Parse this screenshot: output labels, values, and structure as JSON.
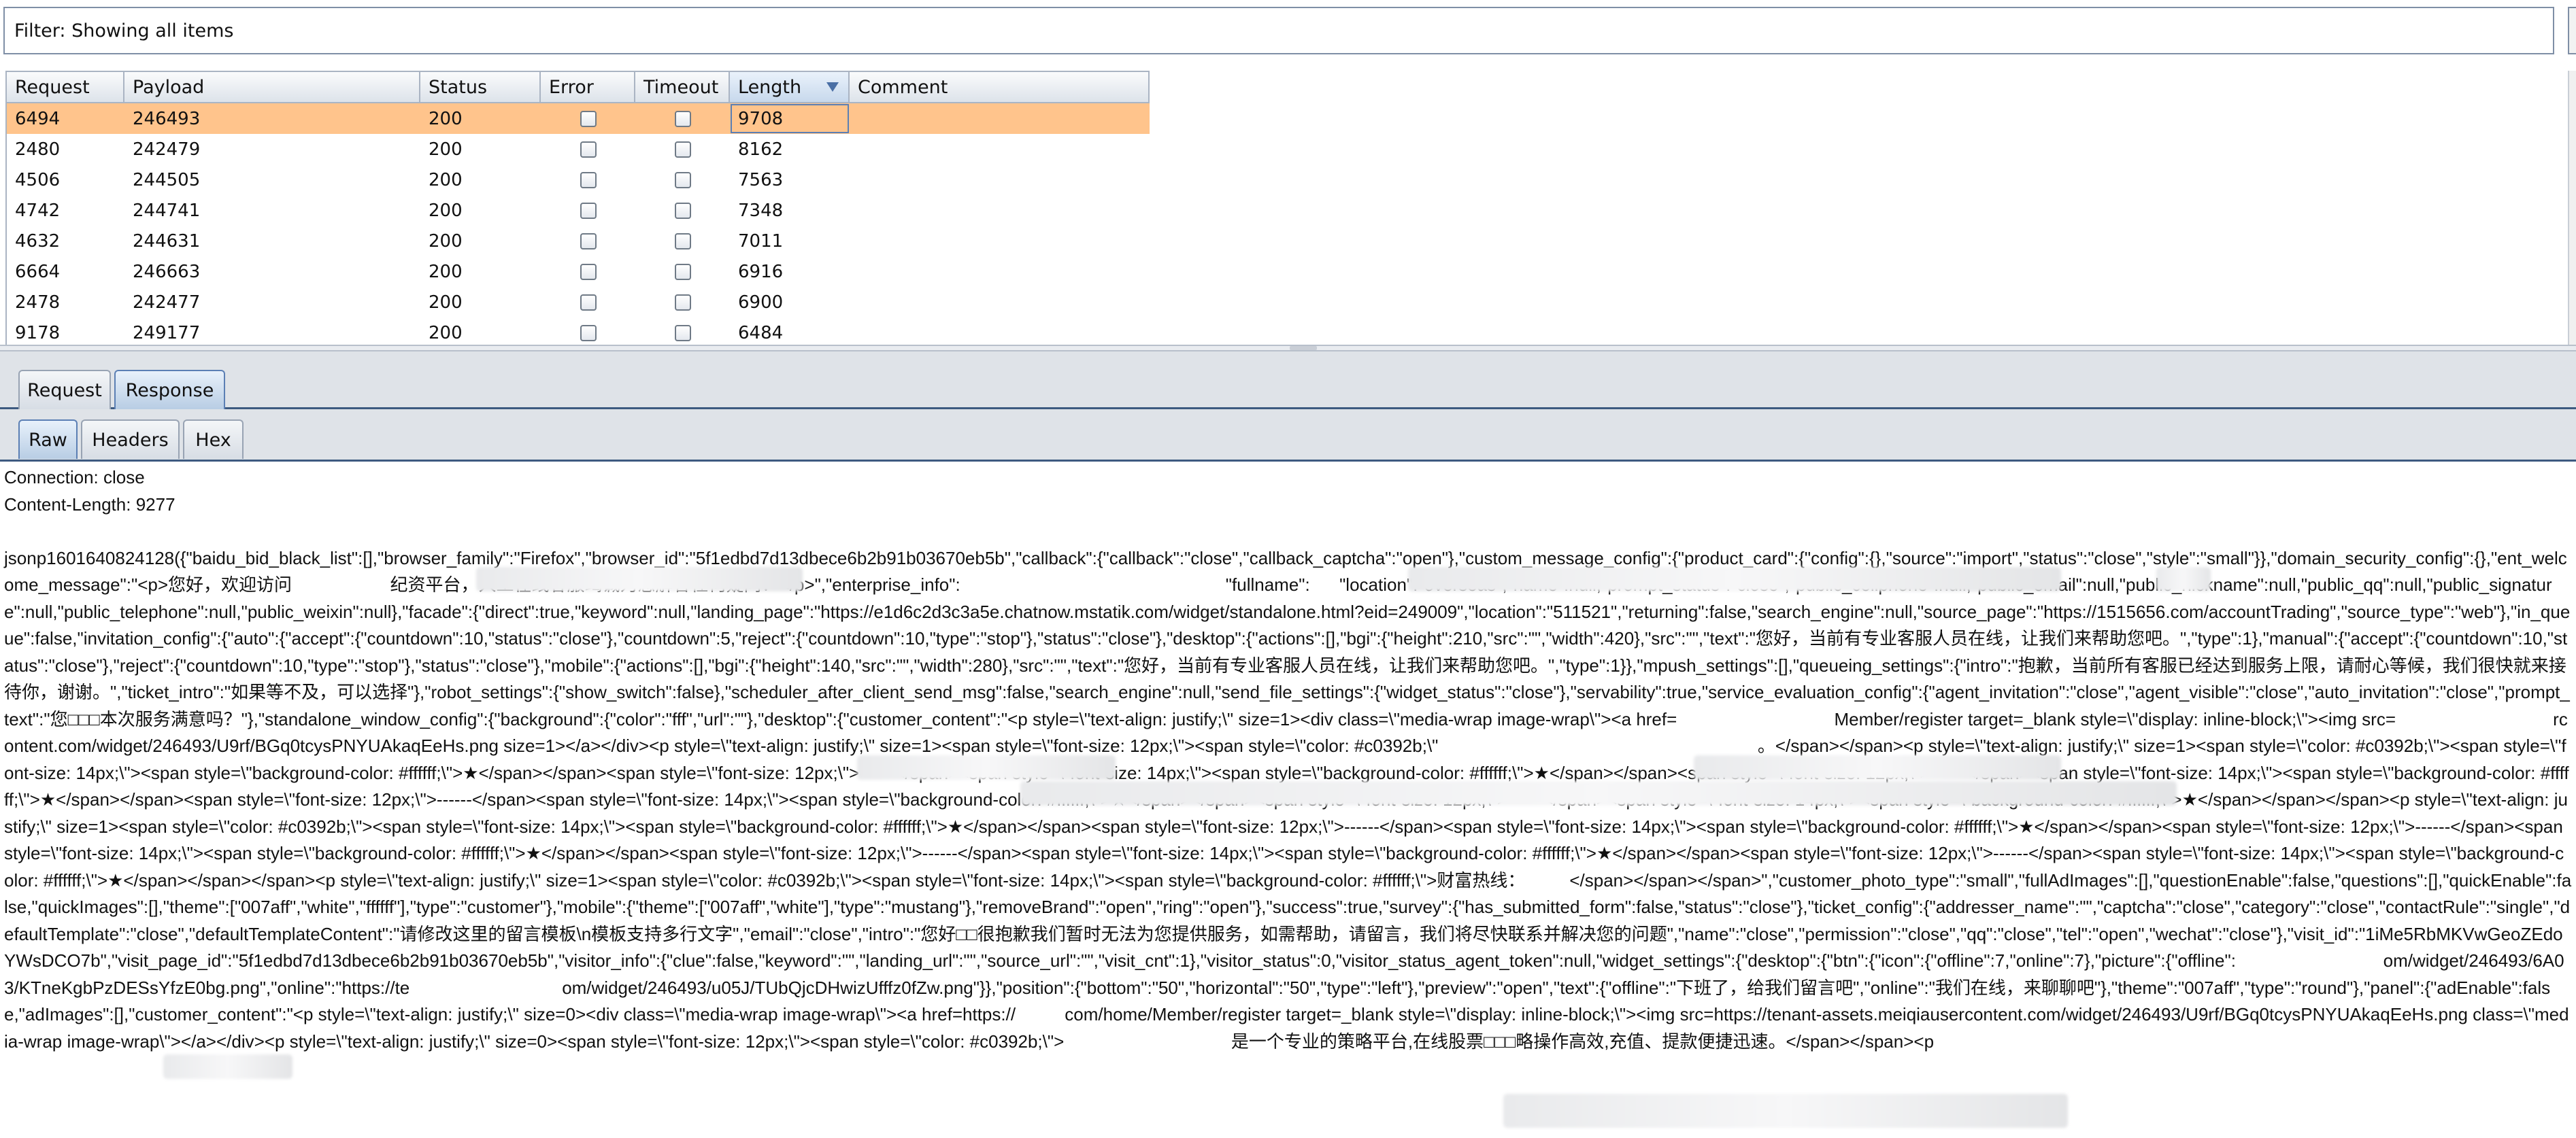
{
  "filter": {
    "text": "Filter:  Showing all items"
  },
  "table": {
    "columns": [
      "Request",
      "Payload",
      "Status",
      "Error",
      "Timeout",
      "Length",
      "Comment"
    ],
    "sorted_column": "Length",
    "rows": [
      {
        "request": "6494",
        "payload": "246493",
        "status": "200",
        "length": "9708",
        "selected": true
      },
      {
        "request": "2480",
        "payload": "242479",
        "status": "200",
        "length": "8162"
      },
      {
        "request": "4506",
        "payload": "244505",
        "status": "200",
        "length": "7563"
      },
      {
        "request": "4742",
        "payload": "244741",
        "status": "200",
        "length": "7348"
      },
      {
        "request": "4632",
        "payload": "244631",
        "status": "200",
        "length": "7011"
      },
      {
        "request": "6664",
        "payload": "246663",
        "status": "200",
        "length": "6916"
      },
      {
        "request": "2478",
        "payload": "242477",
        "status": "200",
        "length": "6900"
      },
      {
        "request": "9178",
        "payload": "249177",
        "status": "200",
        "length": "6484"
      }
    ]
  },
  "tabs": {
    "outer": [
      {
        "label": "Request"
      },
      {
        "label": "Response",
        "active": true
      }
    ],
    "inner": [
      {
        "label": "Raw",
        "active": true
      },
      {
        "label": "Headers"
      },
      {
        "label": "Hex"
      }
    ]
  },
  "response": {
    "headers": [
      "Connection: close",
      "Content-Length: 9277"
    ],
    "body": "jsonp1601640824128({\"baidu_bid_black_list\":[],\"browser_family\":\"Firefox\",\"browser_id\":\"5f1edbd7d13dbece6b2b91b03670eb5b\",\"callback\":{\"callback\":\"close\",\"callback_captcha\":\"open\"},\"custom_message_config\":{\"product_card\":{\"config\":{},\"source\":\"import\",\"status\":\"close\",\"style\":\"small\"}},\"domain_security_config\":{},\"ent_welcome_message\":\"<p>您好，欢迎访问                    纪资平台，人工在线客服竭诚为您解答任何疑问！</p>\",\"enterprise_info\":                                                      \"fullname\":      \"location\":\"overseas\",\"name\":null,\"prompt_status\":\"close\",\"public_cellphone\":null,\"public_email\":null,\"public_nickname\":null,\"public_qq\":null,\"public_signature\":null,\"public_telephone\":null,\"public_weixin\":null},\"facade\":{\"direct\":true,\"keyword\":null,\"landing_page\":\"https://e1d6c2d3c3a5e.chatnow.mstatik.com/widget/standalone.html?eid=249009\",\"location\":\"511521\",\"returning\":false,\"search_engine\":null,\"source_page\":\"https://1515656.com/accountTrading\",\"source_type\":\"web\"},\"in_queue\":false,\"invitation_config\":{\"auto\":{\"accept\":{\"countdown\":10,\"status\":\"close\"},\"countdown\":5,\"reject\":{\"countdown\":10,\"type\":\"stop\"},\"status\":\"close\"},\"desktop\":{\"actions\":[],\"bgi\":{\"height\":210,\"src\":\"\",\"width\":420},\"src\":\"\",\"text\":\"您好，当前有专业客服人员在线，让我们来帮助您吧。\",\"type\":1},\"manual\":{\"accept\":{\"countdown\":10,\"status\":\"close\"},\"reject\":{\"countdown\":10,\"type\":\"stop\"},\"status\":\"close\"},\"mobile\":{\"actions\":[],\"bgi\":{\"height\":140,\"src\":\"\",\"width\":280},\"src\":\"\",\"text\":\"您好，当前有专业客服人员在线，让我们来帮助您吧。\",\"type\":1}},\"mpush_settings\":[],\"queueing_settings\":{\"intro\":\"抱歉，当前所有客服已经达到服务上限，请耐心等候，我们很快就来接待你，谢谢。\",\"ticket_intro\":\"如果等不及，可以选择\"},\"robot_settings\":{\"show_switch\":false},\"scheduler_after_client_send_msg\":false,\"search_engine\":null,\"send_file_settings\":{\"widget_status\":\"close\"},\"servability\":true,\"service_evaluation_config\":{\"agent_invitation\":\"close\",\"agent_visible\":\"close\",\"auto_invitation\":\"close\",\"prompt_text\":\"您□□□本次服务满意吗？\"},\"standalone_window_config\":{\"background\":{\"color\":\"fff\",\"url\":\"\"},\"desktop\":{\"customer_content\":\"<p style=\\\"text-align: justify;\\\" size=1><div class=\\\"media-wrap image-wrap\\\"><a href=                                Member/register target=_blank style=\\\"display: inline-block;\\\"><img src=                                rcontent.com/widget/246493/U9rf/BGq0tcysPNYUAkaqEeHs.png size=1></a></div><p style=\\\"text-align: justify;\\\" size=1><span style=\\\"font-size: 12px;\\\"><span style=\\\"color: #c0392b;\\\"                                                                 。</span></span><p style=\\\"text-align: justify;\\\" size=1><span style=\\\"color: #c0392b;\\\"><span style=\\\"font-size: 14px;\\\"><span style=\\\"background-color: #ffffff;\\\">★</span></span><span style=\\\"font-size: 12px;\\\">------</span><span style=\\\"font-size: 14px;\\\"><span style=\\\"background-color: #ffffff;\\\">★</span></span><span style=\\\"font-size: 12px;\\\">------</span><span style=\\\"font-size: 14px;\\\"><span style=\\\"background-color: #ffffff;\\\">★</span></span><span style=\\\"font-size: 12px;\\\">------</span><span style=\\\"font-size: 14px;\\\"><span style=\\\"background-color: #ffffff;\\\">★</span></span><span style=\\\"font-size: 12px;\\\">------</span><span style=\\\"font-size: 14px;\\\"><span style=\\\"background-color: #ffffff;\\\">★</span></span></span><p style=\\\"text-align: justify;\\\" size=1><span style=\\\"color: #c0392b;\\\"><span style=\\\"font-size: 14px;\\\"><span style=\\\"background-color: #ffffff;\\\">★</span></span><span style=\\\"font-size: 12px;\\\">------</span><span style=\\\"font-size: 14px;\\\"><span style=\\\"background-color: #ffffff;\\\">★</span></span><span style=\\\"font-size: 12px;\\\">------</span><span style=\\\"font-size: 14px;\\\"><span style=\\\"background-color: #ffffff;\\\">★</span></span><span style=\\\"font-size: 12px;\\\">------</span><span style=\\\"font-size: 14px;\\\"><span style=\\\"background-color: #ffffff;\\\">★</span></span><span style=\\\"font-size: 12px;\\\">------</span><span style=\\\"font-size: 14px;\\\"><span style=\\\"background-color: #ffffff;\\\">★</span></span></span><p style=\\\"text-align: justify;\\\" size=1><span style=\\\"color: #c0392b;\\\"><span style=\\\"font-size: 14px;\\\"><span style=\\\"background-color: #ffffff;\\\">财富热线：         </span></span></span>\",\"customer_photo_type\":\"small\",\"fullAdImages\":[],\"questionEnable\":false,\"questions\":[],\"quickEnable\":false,\"quickImages\":[],\"theme\":[\"007aff\",\"white\",\"ffffff\"],\"type\":\"customer\"},\"mobile\":{\"theme\":[\"007aff\",\"white\"],\"type\":\"mustang\"},\"removeBrand\":\"open\",\"ring\":\"open\"},\"success\":true,\"survey\":{\"has_submitted_form\":false,\"status\":\"close\"},\"ticket_config\":{\"addresser_name\":\"\",\"captcha\":\"close\",\"category\":\"close\",\"contactRule\":\"single\",\"defaultTemplate\":\"close\",\"defaultTemplateContent\":\"请修改这里的留言模板\\n模板支持多行文字\",\"email\":\"close\",\"intro\":\"您好□□很抱歉我们暂时无法为您提供服务，如需帮助，请留言，我们将尽快联系并解决您的问题\",\"name\":\"close\",\"permission\":\"close\",\"qq\":\"close\",\"tel\":\"open\",\"wechat\":\"close\"},\"visit_id\":\"1iMe5RbMKVwGeoZEdoYWsDCO7b\",\"visit_page_id\":\"5f1edbd7d13dbece6b2b91b03670eb5b\",\"visitor_info\":{\"clue\":false,\"keyword\":\"\",\"landing_url\":\"\",\"source_url\":\"\",\"visit_cnt\":1},\"visitor_status\":0,\"visitor_status_agent_token\":null,\"widget_settings\":{\"desktop\":{\"btn\":{\"icon\":{\"offline\":7,\"online\":7},\"picture\":{\"offline\":                              om/widget/246493/6A03/KTneKgbPzDESsYfzE0bg.png\",\"online\":\"https://te                               om/widget/246493/u05J/TUbQjcDHwizUfffz0fZw.png\"}},\"position\":{\"bottom\":\"50\",\"horizontal\":\"50\",\"type\":\"left\"},\"preview\":\"open\",\"text\":{\"offline\":\"下班了，给我们留言吧\",\"online\":\"我们在线，来聊聊吧\"},\"theme\":\"007aff\",\"type\":\"round\"},\"panel\":{\"adEnable\":false,\"adImages\":[],\"customer_content\":\"<p style=\\\"text-align: justify;\\\" size=0><div class=\\\"media-wrap image-wrap\\\"><a href=https://          com/home/Member/register target=_blank style=\\\"display: inline-block;\\\"><img src=https://tenant-assets.meiqiausercontent.com/widget/246493/U9rf/BGq0tcysPNYUAkaqEeHs.png class=\\\"media-wrap image-wrap\\\"></a></div><p style=\\\"text-align: justify;\\\" size=0><span style=\\\"font-size: 12px;\\\"><span style=\\\"color: #c0392b;\\\">                                  是一个专业的策略平台,在线股票□□□略操作高效,充值、提款便捷迅速。</span></span><p"
  },
  "colors": {
    "selected_row": "#ffc48c",
    "tab_border": "#3d5a80",
    "header_border": "#aab4c3"
  }
}
